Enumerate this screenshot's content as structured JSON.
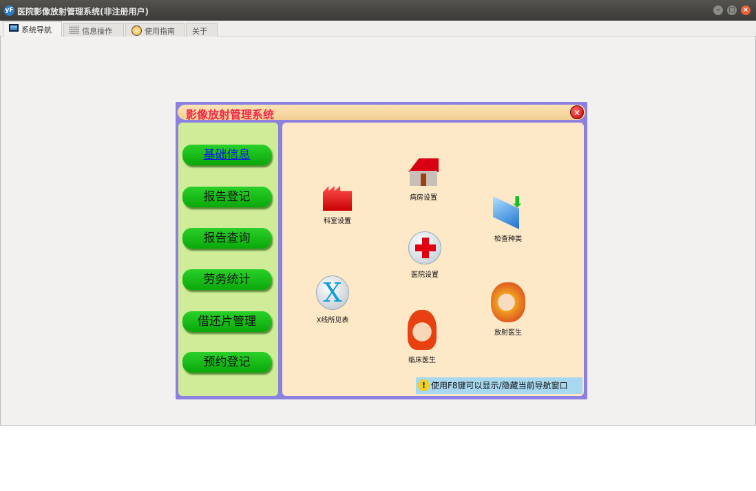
{
  "window": {
    "title": "医院影像放射管理系统(非注册用户)",
    "logo": "yF"
  },
  "tabs": [
    {
      "label": "系统导航",
      "icon": "monitor-icon"
    },
    {
      "label": "信息操作",
      "icon": "grid-icon"
    },
    {
      "label": "使用指南",
      "icon": "help-icon"
    },
    {
      "label": "关于"
    }
  ],
  "panel": {
    "title": "影像放射管理系统",
    "nav": [
      "基础信息",
      "报告登记",
      "报告查询",
      "劳务统计",
      "借还片管理",
      "预约登记"
    ],
    "items": {
      "dept": "科室设置",
      "ward": "病房设置",
      "exam": "检查种类",
      "hospital": "医院设置",
      "xray": "X线所见表",
      "clinical": "临床医生",
      "radiology": "放射医生"
    },
    "hint": "使用F8键可以显示/隐藏当前导航窗口"
  }
}
